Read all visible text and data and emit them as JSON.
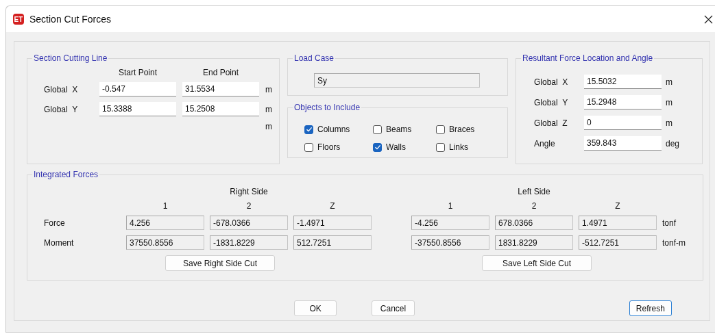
{
  "window": {
    "icon_text": "ET",
    "title": "Section Cut Forces"
  },
  "section_cutting_line": {
    "title": "Section Cutting Line",
    "columns": [
      "Start Point",
      "End Point"
    ],
    "rows": [
      {
        "label": "Global  X",
        "start": "-0.547",
        "end": "31.5534",
        "unit": "m"
      },
      {
        "label": "Global  Y",
        "start": "15.3388",
        "end": "15.2508",
        "unit": "m"
      }
    ],
    "extra_unit": "m"
  },
  "load_case": {
    "title": "Load Case",
    "value": "Sy"
  },
  "objects_to_include": {
    "title": "Objects to Include",
    "items": [
      {
        "label": "Columns",
        "checked": true
      },
      {
        "label": "Beams",
        "checked": false
      },
      {
        "label": "Braces",
        "checked": false
      },
      {
        "label": "Floors",
        "checked": false
      },
      {
        "label": "Walls",
        "checked": true
      },
      {
        "label": "Links",
        "checked": false
      }
    ]
  },
  "resultant": {
    "title": "Resultant Force Location and Angle",
    "rows": [
      {
        "label": "Global  X",
        "value": "15.5032",
        "unit": "m"
      },
      {
        "label": "Global  Y",
        "value": "15.2948",
        "unit": "m"
      },
      {
        "label": "Global  Z",
        "value": "0",
        "unit": "m"
      },
      {
        "label": "Angle",
        "value": "359.843",
        "unit": "deg"
      }
    ]
  },
  "integrated_forces": {
    "title": "Integrated Forces",
    "row_labels": [
      "Force",
      "Moment"
    ],
    "units": [
      "tonf",
      "tonf-m"
    ],
    "sides": [
      {
        "title": "Right Side",
        "columns": [
          "1",
          "2",
          "Z"
        ],
        "rows": [
          [
            "4.256",
            "-678.0366",
            "-1.4971"
          ],
          [
            "37550.8556",
            "-1831.8229",
            "512.7251"
          ]
        ],
        "button": "Save Right Side Cut"
      },
      {
        "title": "Left Side",
        "columns": [
          "1",
          "2",
          "Z"
        ],
        "rows": [
          [
            "-4.256",
            "678.0366",
            "1.4971"
          ],
          [
            "-37550.8556",
            "1831.8229",
            "-512.7251"
          ]
        ],
        "button": "Save Left Side Cut"
      }
    ]
  },
  "buttons": [
    {
      "label": "OK",
      "default": false
    },
    {
      "label": "Cancel",
      "default": false
    },
    {
      "label": "Refresh",
      "default": true
    }
  ]
}
